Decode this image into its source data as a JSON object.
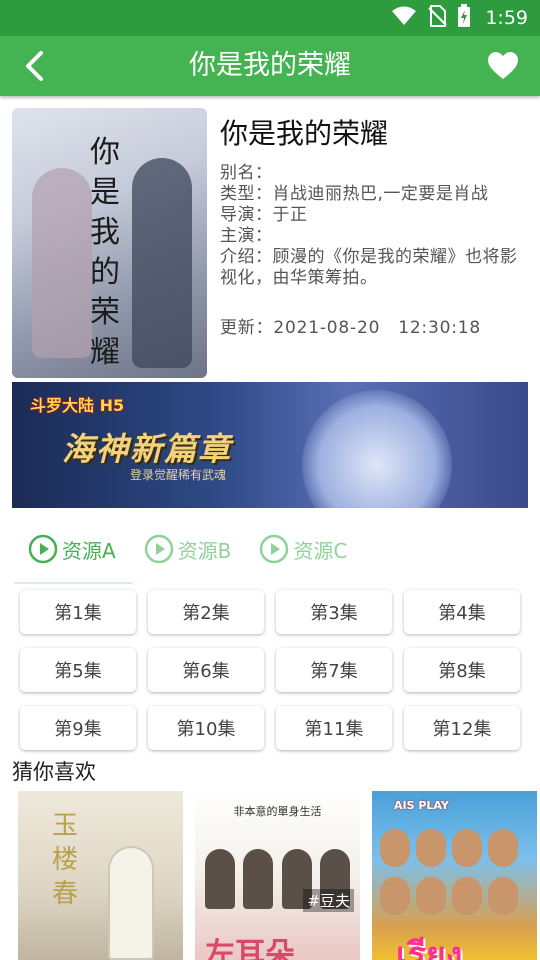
{
  "status_bar": {
    "time": "1:59",
    "icons": [
      "wifi-icon",
      "no-sim-icon",
      "battery-charging-icon"
    ]
  },
  "app_bar": {
    "title": "你是我的荣耀",
    "back_icon": "chevron-left-icon",
    "favorite_icon": "heart-icon"
  },
  "detail": {
    "title": "你是我的荣耀",
    "poster_caption": "你是我的荣耀",
    "info": [
      {
        "label": "别名：",
        "value": ""
      },
      {
        "label": "类型：",
        "value": "肖战迪丽热巴,一定要是肖战"
      },
      {
        "label": "导演：",
        "value": "于正"
      },
      {
        "label": "主演：",
        "value": ""
      },
      {
        "label": "介绍：",
        "value": "顾漫的《你是我的荣耀》也将影视化，由华策筹拍。"
      }
    ],
    "update_label": "更新：",
    "update_date": "2021-08-20",
    "update_time": "12:30:18"
  },
  "banner": {
    "logo": "斗罗大陆 H5",
    "title": "海神新篇章",
    "subtitle": "登录觉醒稀有武魂"
  },
  "sources": [
    {
      "label": "资源A",
      "active": true
    },
    {
      "label": "资源B",
      "active": false
    },
    {
      "label": "资源C",
      "active": false
    }
  ],
  "episodes": [
    "第1集",
    "第2集",
    "第3集",
    "第4集",
    "第5集",
    "第6集",
    "第7集",
    "第8集",
    "第9集",
    "第10集",
    "第11集",
    "第12集"
  ],
  "recommend": {
    "title": "猜你喜欢",
    "items": [
      {
        "poster_text": "玉楼春"
      },
      {
        "poster_top": "非本意的單身生活",
        "tag": "#豆夫",
        "poster_bottom": "左耳朵"
      },
      {
        "poster_top": "AIS PLAY",
        "poster_bottom": "เรียง"
      }
    ]
  },
  "colors": {
    "status_bar": "#2e9c3e",
    "app_bar": "#44b452",
    "accent": "#45b054",
    "accent_light": "#8fd39a"
  }
}
